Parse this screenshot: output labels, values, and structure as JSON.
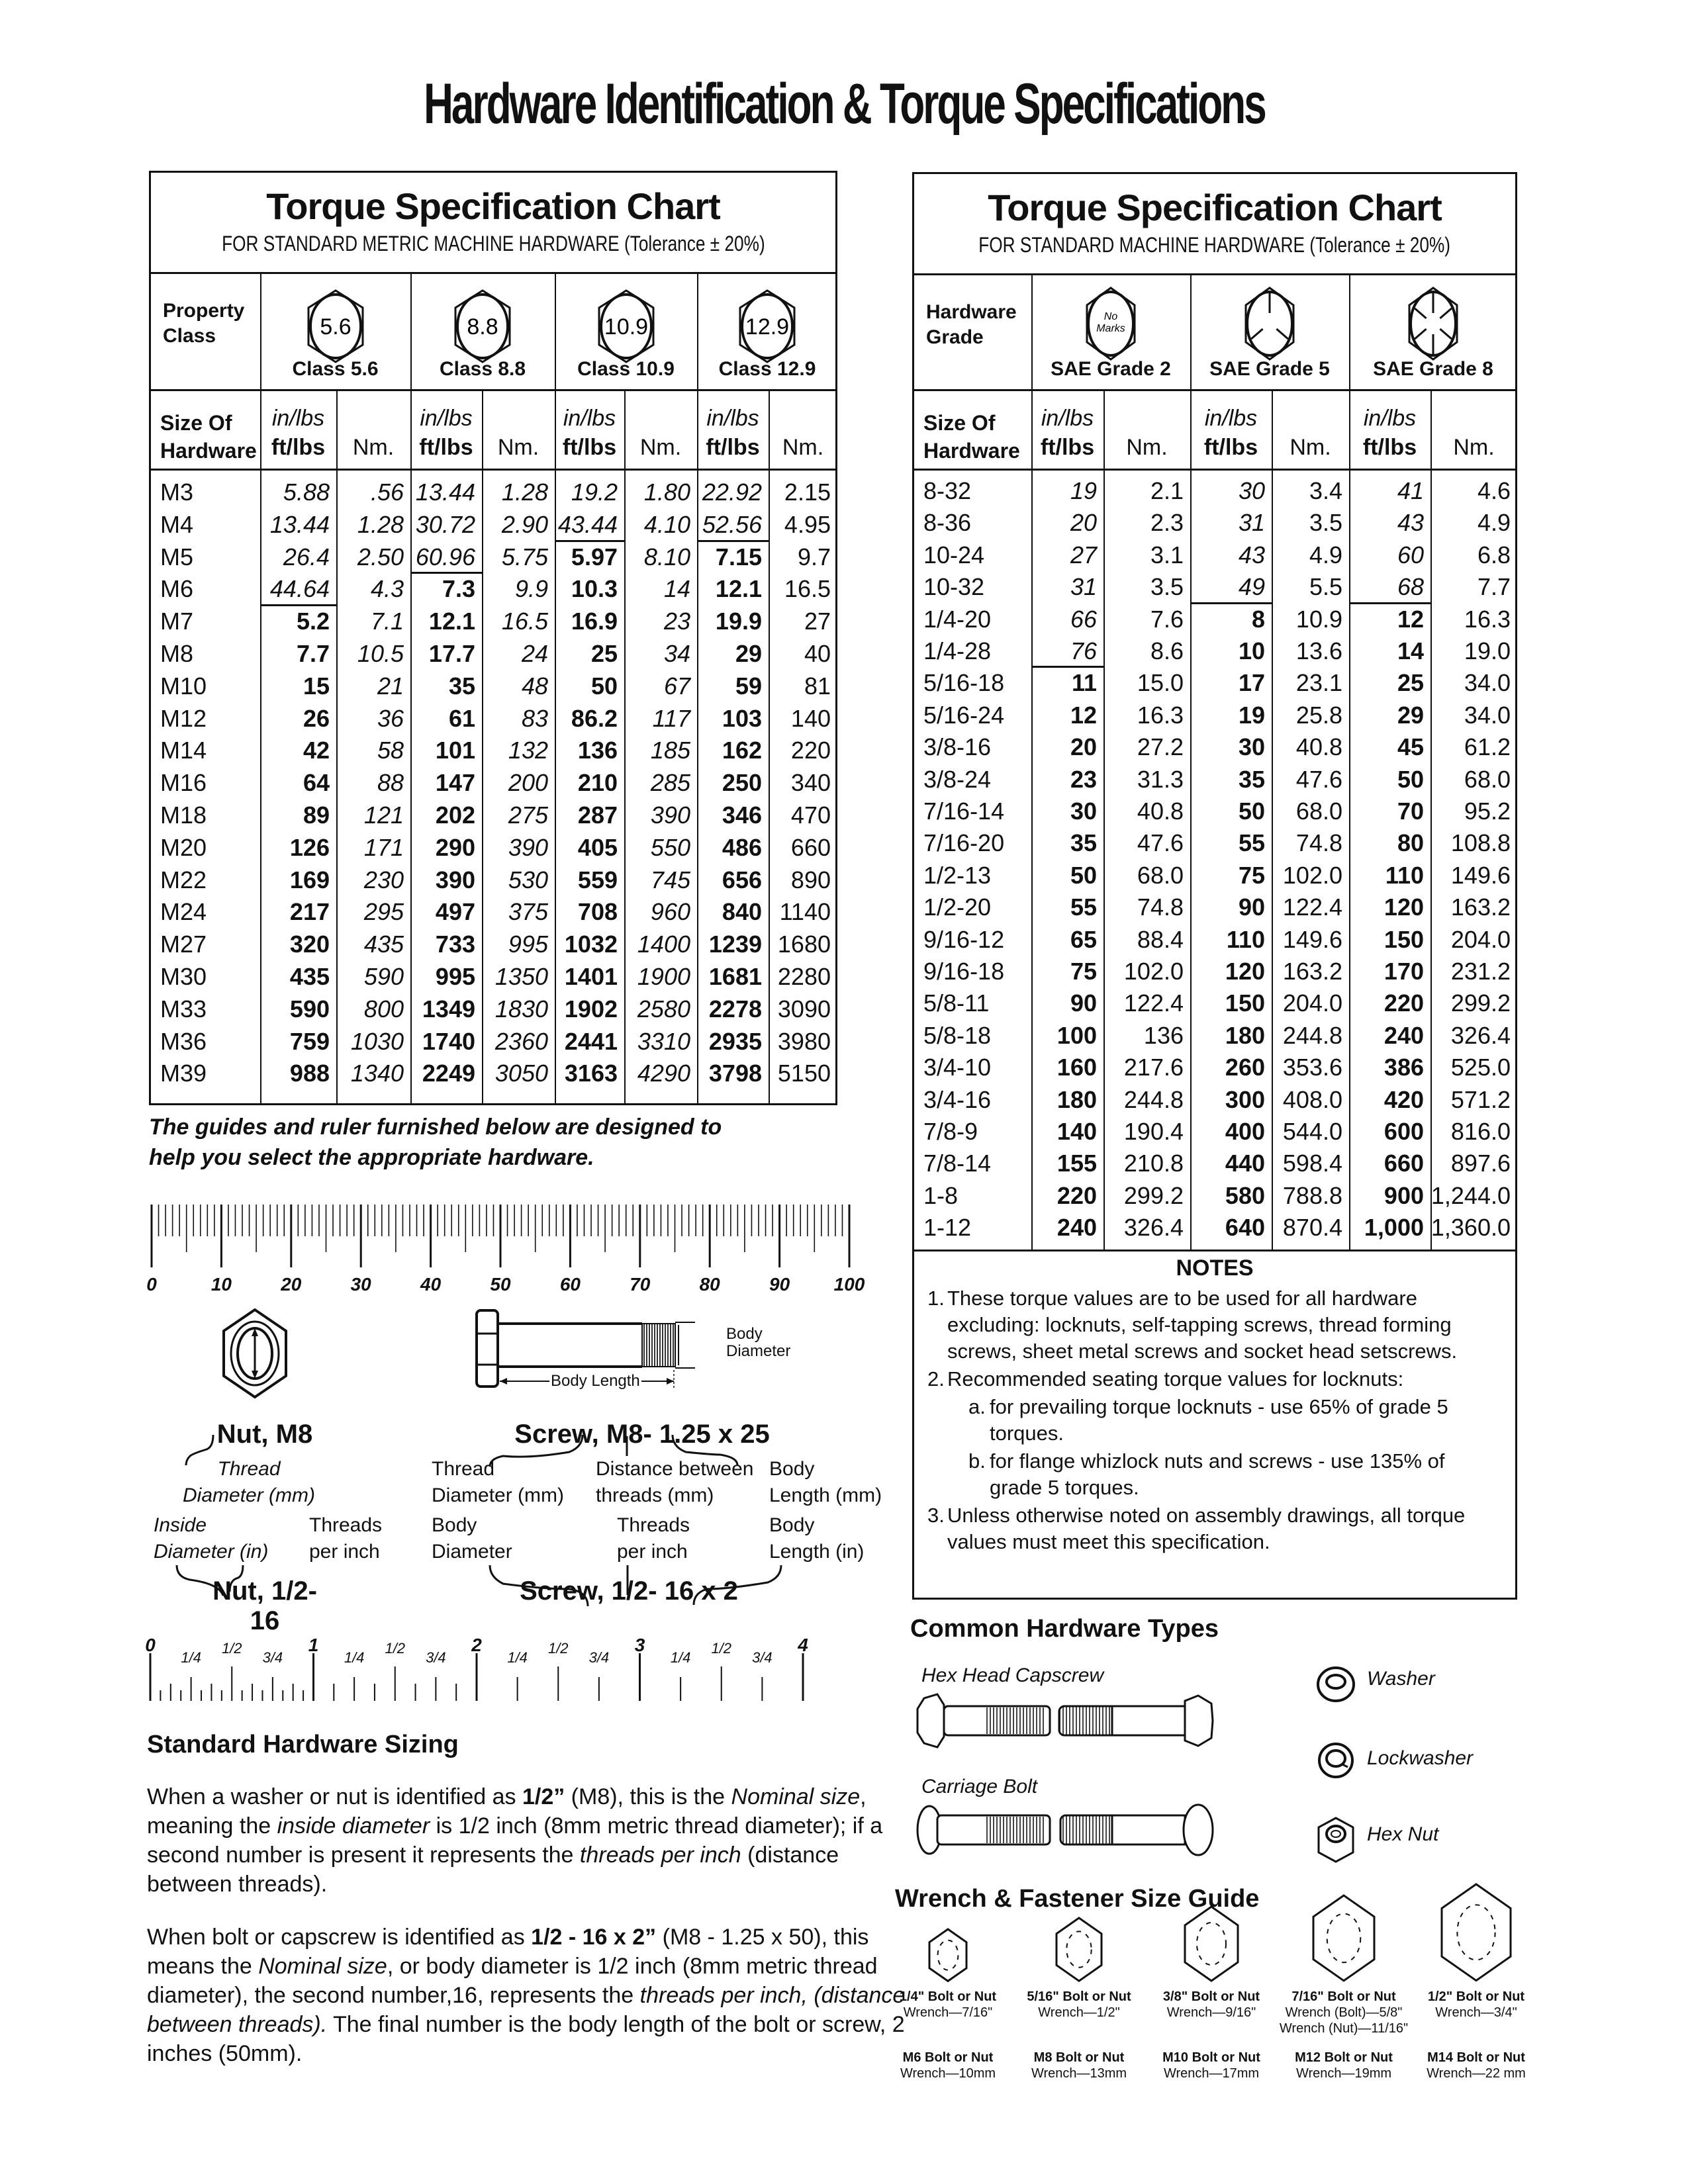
{
  "page": {
    "title": "Hardware Identification  &  Torque Specifications"
  },
  "metric_chart": {
    "title": "Torque Specification Chart",
    "subtitle": "FOR STANDARD METRIC MACHINE HARDWARE (Tolerance ± 20%)",
    "property_class_label_1": "Property",
    "property_class_label_2": "Class",
    "classes": [
      {
        "mark": "5.6",
        "label": "Class 5.6",
        "icon": "hex-bolt-head-icon"
      },
      {
        "mark": "8.8",
        "label": "Class 8.8",
        "icon": "hex-bolt-head-icon"
      },
      {
        "mark": "10.9",
        "label": "Class 10.9",
        "icon": "hex-bolt-head-icon"
      },
      {
        "mark": "12.9",
        "label": "Class 12.9",
        "icon": "hex-bolt-head-icon"
      }
    ],
    "size_label_1": "Size Of",
    "size_label_2": "Hardware",
    "unit_inlbs": "in/lbs",
    "unit_ftlbs": "ft/lbs",
    "unit_nm": "Nm.",
    "rows": [
      {
        "size": "M3",
        "v": [
          "5.88",
          ".56",
          "13.44",
          "1.28",
          "19.2",
          "1.80",
          "22.92",
          "2.15"
        ]
      },
      {
        "size": "M4",
        "v": [
          "13.44",
          "1.28",
          "30.72",
          "2.90",
          "43.44",
          "4.10",
          "52.56",
          "4.95"
        ]
      },
      {
        "size": "M5",
        "v": [
          "26.4",
          "2.50",
          "60.96",
          "5.75",
          "5.97",
          "8.10",
          "7.15",
          "9.7"
        ]
      },
      {
        "size": "M6",
        "v": [
          "44.64",
          "4.3",
          "7.3",
          "9.9",
          "10.3",
          "14",
          "12.1",
          "16.5"
        ]
      },
      {
        "size": "M7",
        "v": [
          "5.2",
          "7.1",
          "12.1",
          "16.5",
          "16.9",
          "23",
          "19.9",
          "27"
        ]
      },
      {
        "size": "M8",
        "v": [
          "7.7",
          "10.5",
          "17.7",
          "24",
          "25",
          "34",
          "29",
          "40"
        ]
      },
      {
        "size": "M10",
        "v": [
          "15",
          "21",
          "35",
          "48",
          "50",
          "67",
          "59",
          "81"
        ]
      },
      {
        "size": "M12",
        "v": [
          "26",
          "36",
          "61",
          "83",
          "86.2",
          "117",
          "103",
          "140"
        ]
      },
      {
        "size": "M14",
        "v": [
          "42",
          "58",
          "101",
          "132",
          "136",
          "185",
          "162",
          "220"
        ]
      },
      {
        "size": "M16",
        "v": [
          "64",
          "88",
          "147",
          "200",
          "210",
          "285",
          "250",
          "340"
        ]
      },
      {
        "size": "M18",
        "v": [
          "89",
          "121",
          "202",
          "275",
          "287",
          "390",
          "346",
          "470"
        ]
      },
      {
        "size": "M20",
        "v": [
          "126",
          "171",
          "290",
          "390",
          "405",
          "550",
          "486",
          "660"
        ]
      },
      {
        "size": "M22",
        "v": [
          "169",
          "230",
          "390",
          "530",
          "559",
          "745",
          "656",
          "890"
        ]
      },
      {
        "size": "M24",
        "v": [
          "217",
          "295",
          "497",
          "375",
          "708",
          "960",
          "840",
          "1140"
        ]
      },
      {
        "size": "M27",
        "v": [
          "320",
          "435",
          "733",
          "995",
          "1032",
          "1400",
          "1239",
          "1680"
        ]
      },
      {
        "size": "M30",
        "v": [
          "435",
          "590",
          "995",
          "1350",
          "1401",
          "1900",
          "1681",
          "2280"
        ]
      },
      {
        "size": "M33",
        "v": [
          "590",
          "800",
          "1349",
          "1830",
          "1902",
          "2580",
          "2278",
          "3090"
        ]
      },
      {
        "size": "M36",
        "v": [
          "759",
          "1030",
          "1740",
          "2360",
          "2441",
          "3310",
          "2935",
          "3980"
        ]
      },
      {
        "size": "M39",
        "v": [
          "988",
          "1340",
          "2249",
          "3050",
          "3163",
          "4290",
          "3798",
          "5150"
        ]
      }
    ],
    "inlbs_rows_per_class": [
      4,
      3,
      2,
      2
    ]
  },
  "sae_chart": {
    "title": "Torque Specification Chart",
    "subtitle": "FOR STANDARD MACHINE HARDWARE (Tolerance ± 20%)",
    "grade_label_1": "Hardware",
    "grade_label_2": "Grade",
    "grades": [
      {
        "mark": "No Marks",
        "mark_1": "No",
        "mark_2": "Marks",
        "label": "SAE Grade 2",
        "icon": "hex-bolt-no-marks-icon"
      },
      {
        "mark": "3 radial lines",
        "label": "SAE Grade 5",
        "icon": "hex-bolt-3-lines-icon"
      },
      {
        "mark": "6 radial lines",
        "label": "SAE Grade 8",
        "icon": "hex-bolt-6-lines-icon"
      }
    ],
    "size_label_1": "Size Of",
    "size_label_2": "Hardware",
    "unit_inlbs": "in/lbs",
    "unit_ftlbs": "ft/lbs",
    "unit_nm": "Nm.",
    "rows": [
      {
        "size": "8-32",
        "v": [
          "19",
          "2.1",
          "30",
          "3.4",
          "41",
          "4.6"
        ]
      },
      {
        "size": "8-36",
        "v": [
          "20",
          "2.3",
          "31",
          "3.5",
          "43",
          "4.9"
        ]
      },
      {
        "size": "10-24",
        "v": [
          "27",
          "3.1",
          "43",
          "4.9",
          "60",
          "6.8"
        ]
      },
      {
        "size": "10-32",
        "v": [
          "31",
          "3.5",
          "49",
          "5.5",
          "68",
          "7.7"
        ]
      },
      {
        "size": "1/4-20",
        "v": [
          "66",
          "7.6",
          "8",
          "10.9",
          "12",
          "16.3"
        ]
      },
      {
        "size": "1/4-28",
        "v": [
          "76",
          "8.6",
          "10",
          "13.6",
          "14",
          "19.0"
        ]
      },
      {
        "size": "5/16-18",
        "v": [
          "11",
          "15.0",
          "17",
          "23.1",
          "25",
          "34.0"
        ]
      },
      {
        "size": "5/16-24",
        "v": [
          "12",
          "16.3",
          "19",
          "25.8",
          "29",
          "34.0"
        ]
      },
      {
        "size": "3/8-16",
        "v": [
          "20",
          "27.2",
          "30",
          "40.8",
          "45",
          "61.2"
        ]
      },
      {
        "size": "3/8-24",
        "v": [
          "23",
          "31.3",
          "35",
          "47.6",
          "50",
          "68.0"
        ]
      },
      {
        "size": "7/16-14",
        "v": [
          "30",
          "40.8",
          "50",
          "68.0",
          "70",
          "95.2"
        ]
      },
      {
        "size": "7/16-20",
        "v": [
          "35",
          "47.6",
          "55",
          "74.8",
          "80",
          "108.8"
        ]
      },
      {
        "size": "1/2-13",
        "v": [
          "50",
          "68.0",
          "75",
          "102.0",
          "110",
          "149.6"
        ]
      },
      {
        "size": "1/2-20",
        "v": [
          "55",
          "74.8",
          "90",
          "122.4",
          "120",
          "163.2"
        ]
      },
      {
        "size": "9/16-12",
        "v": [
          "65",
          "88.4",
          "110",
          "149.6",
          "150",
          "204.0"
        ]
      },
      {
        "size": "9/16-18",
        "v": [
          "75",
          "102.0",
          "120",
          "163.2",
          "170",
          "231.2"
        ]
      },
      {
        "size": "5/8-11",
        "v": [
          "90",
          "122.4",
          "150",
          "204.0",
          "220",
          "299.2"
        ]
      },
      {
        "size": "5/8-18",
        "v": [
          "100",
          "136",
          "180",
          "244.8",
          "240",
          "326.4"
        ]
      },
      {
        "size": "3/4-10",
        "v": [
          "160",
          "217.6",
          "260",
          "353.6",
          "386",
          "525.0"
        ]
      },
      {
        "size": "3/4-16",
        "v": [
          "180",
          "244.8",
          "300",
          "408.0",
          "420",
          "571.2"
        ]
      },
      {
        "size": "7/8-9",
        "v": [
          "140",
          "190.4",
          "400",
          "544.0",
          "600",
          "816.0"
        ]
      },
      {
        "size": "7/8-14",
        "v": [
          "155",
          "210.8",
          "440",
          "598.4",
          "660",
          "897.6"
        ]
      },
      {
        "size": "1-8",
        "v": [
          "220",
          "299.2",
          "580",
          "788.8",
          "900",
          "1,244.0"
        ]
      },
      {
        "size": "1-12",
        "v": [
          "240",
          "326.4",
          "640",
          "870.4",
          "1,000",
          "1,360.0"
        ]
      }
    ],
    "inlbs_rows_per_grade": [
      6,
      4,
      4
    ],
    "notes": {
      "heading": "NOTES",
      "items": [
        {
          "num": "1.",
          "lines": [
            "These torque values are to be used for all hardware",
            "excluding: locknuts, self-tapping screws, thread forming",
            "screws, sheet metal screws and socket head setscrews."
          ]
        },
        {
          "num": "2.",
          "lines": [
            "Recommended seating torque values for locknuts:"
          ]
        },
        {
          "num": "a.",
          "lines": [
            "for prevailing torque locknuts - use 65% of grade 5",
            "torques."
          ]
        },
        {
          "num": "b.",
          "lines": [
            "for flange whizlock nuts and screws - use 135% of",
            "grade 5 torques."
          ]
        },
        {
          "num": "3.",
          "lines": [
            "Unless otherwise noted on assembly drawings, all torque",
            "values must meet this specification."
          ]
        }
      ]
    }
  },
  "guides": {
    "intro_line_1": "The guides and ruler furnished below are designed to",
    "intro_line_2": "help you select the appropriate hardware.",
    "metric_ruler": {
      "unit": "mm",
      "labels": [
        "0",
        "10",
        "20",
        "30",
        "40",
        "50",
        "60",
        "70",
        "80",
        "90",
        "100"
      ]
    },
    "nut_m8_caption": "Nut, M8",
    "screw_m8_caption": "Screw, M8- 1.25 x 25",
    "body_diameter_label_1": "Body",
    "body_diameter_label_2": "Diameter",
    "body_length_label": "Body Length",
    "nut_metric_anno_1": "Thread",
    "nut_metric_anno_2": "Diameter (mm)",
    "screw_metric_anno": [
      {
        "l1": "Thread",
        "l2": "Diameter (mm)"
      },
      {
        "l1": "Distance between",
        "l2": "threads (mm)"
      },
      {
        "l1": "Body",
        "l2": "Length (mm)"
      }
    ],
    "nut_inch_anno": [
      {
        "l1": "Inside",
        "l2": "Diameter (in)"
      },
      {
        "l1": "Threads",
        "l2": "per inch"
      }
    ],
    "screw_inch_anno": [
      {
        "l1": "Body",
        "l2": "Diameter"
      },
      {
        "l1": "Threads",
        "l2": "per inch"
      },
      {
        "l1": "Body",
        "l2": "Length (in)"
      }
    ],
    "nut_inch_caption": "Nut, 1/2-16",
    "screw_inch_caption": "Screw, 1/2- 16 x 2",
    "inch_ruler": {
      "unit": "in",
      "major_labels": [
        "0",
        "1",
        "2",
        "3",
        "4"
      ],
      "minor_labels": [
        "1/4",
        "1/2",
        "3/4"
      ]
    }
  },
  "sizing": {
    "heading": "Standard Hardware Sizing",
    "p1": {
      "a": "When a washer or nut is identified as ",
      "b": "1/2”",
      "c": " (M8), this is the ",
      "d": "Nominal size",
      "e": ", meaning the ",
      "f": "inside diameter",
      "g": " is 1/2 inch (8mm metric thread diameter); if a second number is present it represents the ",
      "h": "threads per inch",
      "i": " (distance between threads)."
    },
    "p2": {
      "a": "When bolt or capscrew is identified as ",
      "b": "1/2 - 16 x 2”",
      "c": " (M8 - 1.25 x 50), this means the ",
      "d": "Nominal size",
      "e": ", or body diameter is 1/2 inch (8mm metric thread diameter), the second number,16, represents the ",
      "f": "threads per inch, (distance between threads).",
      "g": "  The final number is the body length of the bolt or screw, 2 inches (50mm)."
    }
  },
  "common_types": {
    "heading": "Common Hardware Types",
    "hex_head_capscrew": "Hex Head Capscrew",
    "carriage_bolt": "Carriage Bolt",
    "washer": "Washer",
    "lockwasher": "Lockwasher",
    "hex_nut": "Hex Nut"
  },
  "wrench_guide": {
    "heading": "Wrench & Fastener Size Guide",
    "inch": [
      {
        "bolt": "1/4\" Bolt or Nut",
        "wrench": [
          "Wrench—7/16\""
        ]
      },
      {
        "bolt": "5/16\" Bolt or Nut",
        "wrench": [
          "Wrench—1/2\""
        ]
      },
      {
        "bolt": "3/8\" Bolt or Nut",
        "wrench": [
          "Wrench—9/16\""
        ]
      },
      {
        "bolt": "7/16\" Bolt or Nut",
        "wrench": [
          "Wrench (Bolt)—5/8\"",
          "Wrench (Nut)—11/16\""
        ]
      },
      {
        "bolt": "1/2\" Bolt or Nut",
        "wrench": [
          "Wrench—3/4\""
        ]
      }
    ],
    "metric": [
      {
        "bolt": "M6 Bolt or Nut",
        "wrench": "Wrench—10mm"
      },
      {
        "bolt": "M8 Bolt or Nut",
        "wrench": "Wrench—13mm"
      },
      {
        "bolt": "M10 Bolt or Nut",
        "wrench": "Wrench—17mm"
      },
      {
        "bolt": "M12 Bolt or Nut",
        "wrench": "Wrench—19mm"
      },
      {
        "bolt": "M14 Bolt or Nut",
        "wrench": "Wrench—22 mm"
      }
    ]
  }
}
